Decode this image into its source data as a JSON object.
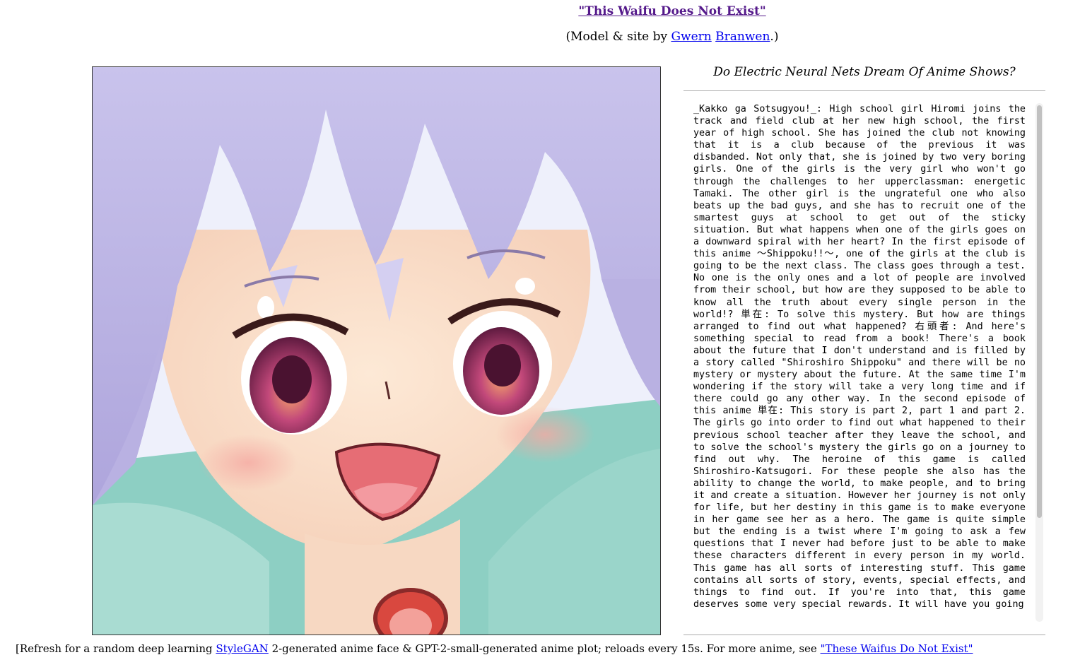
{
  "header": {
    "title_link": "\"This Waifu Does Not Exist\"",
    "credits_prefix": "(Model & site by ",
    "author_first": "Gwern",
    "author_last": "Branwen",
    "credits_suffix": ".)"
  },
  "sidebar": {
    "heading": "Do Electric Neural Nets Dream Of Anime Shows?",
    "story": "_Kakko ga Sotsugyou!_: High school girl Hiromi joins the track and field club at her new high school, the first year of high school. She has joined the club not knowing that it is a club because of the previous it was disbanded. Not only that, she is joined by two very boring girls. One of the girls is the very girl who won't go through the challenges to her upperclassman: energetic Tamaki. The other girl is the ungrateful one who also beats up the bad guys, and she has to recruit one of the smartest guys at school to get out of the sticky situation. But what happens when one of the girls goes on a downward spiral with her heart? In the first episode of this anime 〜Shippoku!!〜, one of the girls at the club is going to be the next class. The class goes through a test. No one is the only ones and a lot of people are involved from their school, but how are they supposed to be able to know all the truth about every single person in the world!? 単在: To solve this mystery. But how are things arranged to find out what happened? 右頭者: And here's something special to read from a book! There's a book about the future that I don't understand and is filled by a story called \"Shiroshiro Shippoku\" and there will be no mystery or mystery about the future. At the same time I'm wondering if the story will take a very long time and if there could go any other way. In the second episode of this anime 単在: This story is part 2, part 1 and part 2. The girls go into order to find out what happened to their previous school teacher after they leave the school, and to solve the school's mystery the girls go on a journey to find out why. The heroine of this game is called Shiroshiro-Katsugori. For these people she also has the ability to change the world, to make people, and to bring it and create a situation. However her journey is not only for life, but her destiny in this game is to make everyone in her game see her as a hero. The game is quite simple but the ending is a twist where I'm going to ask a few questions that I never had before just to be able to make these characters different in every person in my world. This game has all sorts of interesting stuff. This game contains all sorts of story, events, special effects, and things to find out. If you're into that, this game deserves some very special rewards. It will have you going"
  },
  "image": {
    "icon": "anime-girl-portrait"
  },
  "footer": {
    "text_before": "[Refresh for a random deep learning ",
    "link_stylegan": "StyleGAN",
    "text_middle": " 2-generated anime face & GPT-2-small-generated anime plot; reloads every 15s. For more anime, see ",
    "link_end": "\"These Waifus Do Not Exist\""
  }
}
